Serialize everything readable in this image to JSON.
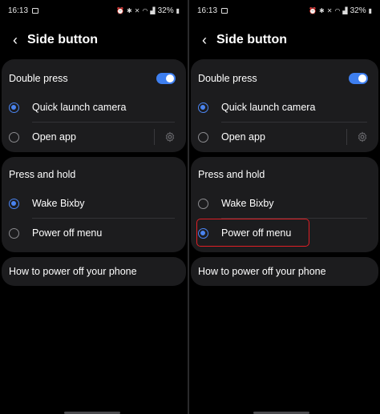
{
  "status": {
    "time": "16:13",
    "battery": "32%"
  },
  "header": {
    "title": "Side button"
  },
  "double_press": {
    "label": "Double press",
    "enabled": true,
    "options": [
      "Quick launch camera",
      "Open app"
    ]
  },
  "press_hold": {
    "label": "Press and hold",
    "options": [
      "Wake Bixby",
      "Power off menu"
    ]
  },
  "help_link": "How to power off your phone",
  "screens": [
    {
      "press_hold_selected": "Wake Bixby",
      "double_press_selected": "Quick launch camera"
    },
    {
      "press_hold_selected": "Power off menu",
      "double_press_selected": "Quick launch camera"
    }
  ],
  "colors": {
    "accent": "#4a84f0",
    "highlight": "#e01f26",
    "card": "#1c1c1e"
  }
}
